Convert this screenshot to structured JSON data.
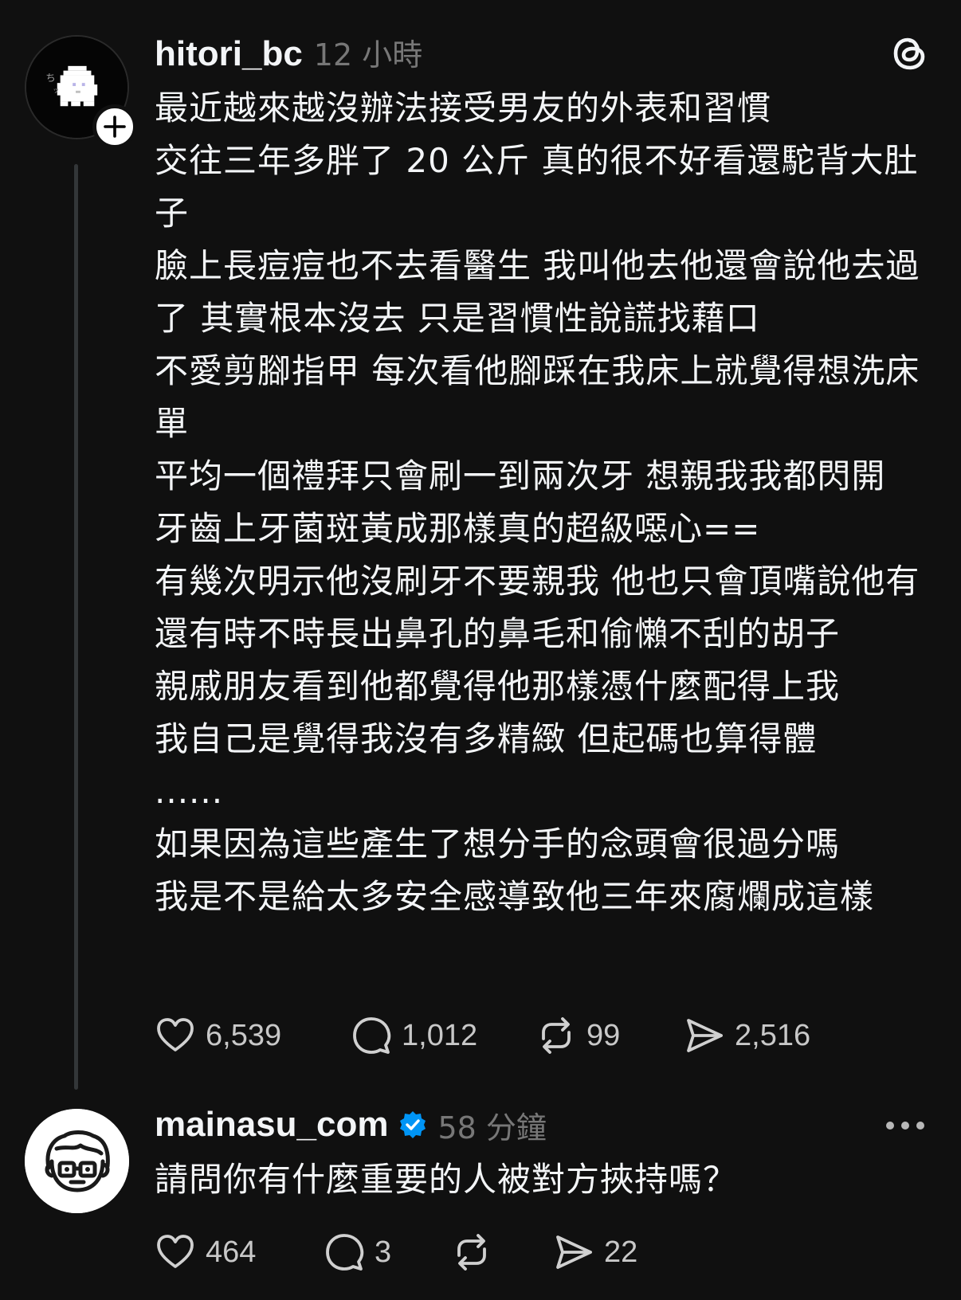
{
  "post": {
    "username": "hitori_bc",
    "time": "12 小時",
    "lines": [
      "最近越來越沒辦法接受男友的外表和習慣",
      "交往三年多胖了 20 公斤 真的很不好看還駝背大肚子",
      "臉上長痘痘也不去看醫生 我叫他去他還會說他去過了 其實根本沒去 只是習慣性說謊找藉口",
      "不愛剪腳指甲 每次看他腳踩在我床上就覺得想洗床單",
      "平均一個禮拜只會刷一到兩次牙 想親我我都閃開",
      "牙齒上牙菌斑黃成那樣真的超級噁心==",
      "有幾次明示他沒刷牙不要親我 他也只會頂嘴說他有",
      "還有時不時長出鼻孔的鼻毛和偷懶不刮的胡子",
      "親戚朋友看到他都覺得他那樣憑什麼配得上我",
      "我自己是覺得我沒有多精緻 但起碼也算得體",
      "......",
      "如果因為這些產生了想分手的念頭會很過分嗎",
      "我是不是給太多安全感導致他三年來腐爛成這樣"
    ],
    "likes": "6,539",
    "comments": "1,012",
    "reposts": "99",
    "shares": "2,516"
  },
  "reply": {
    "username": "mainasu_com",
    "time": "58 分鐘",
    "text": "請問你有什麼重要的人被對方挾持嗎？",
    "likes": "464",
    "comments": "3",
    "shares": "22"
  },
  "colors": {
    "background": "#101010",
    "text": "#f3f5f7",
    "muted": "#777777",
    "verified": "#0095f6"
  },
  "icons": [
    "threads-logo-icon",
    "heart-icon",
    "comment-icon",
    "repost-icon",
    "share-icon",
    "verified-icon",
    "more-icon",
    "plus-icon"
  ]
}
